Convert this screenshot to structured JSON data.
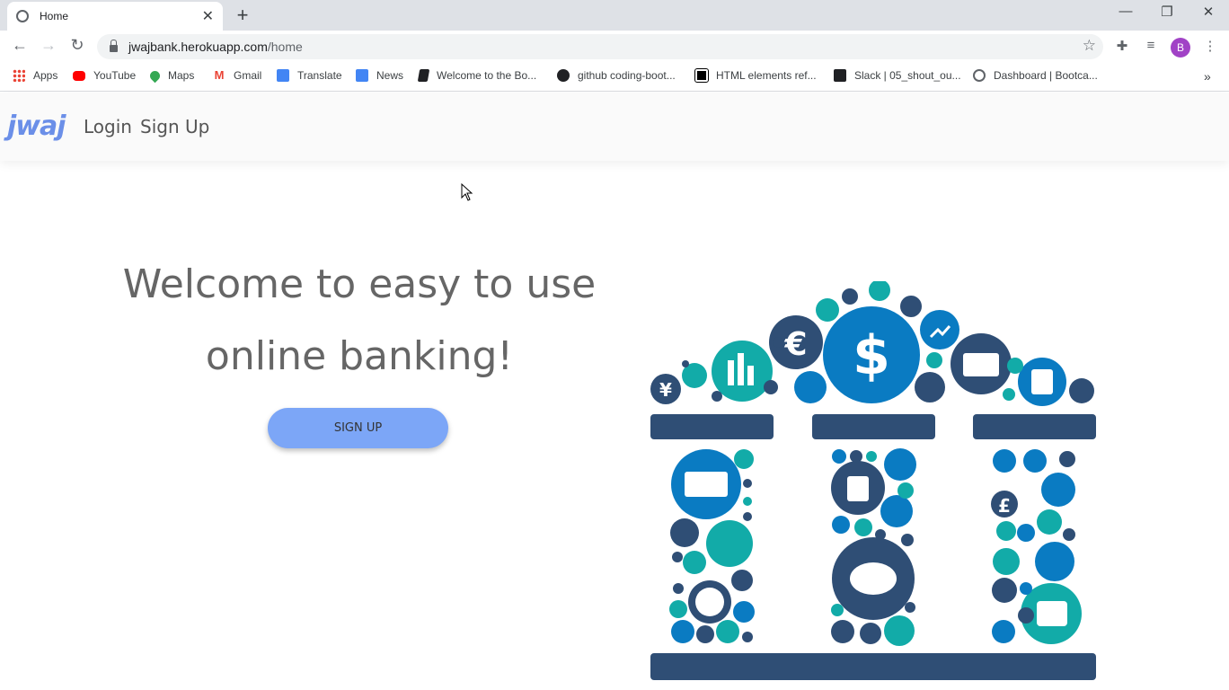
{
  "browser": {
    "tab_title": "Home",
    "tab_close": "✕",
    "new_tab": "+",
    "window_minimize": "—",
    "window_restore": "❐",
    "window_close": "✕",
    "url_host": "jwajbank.herokuapp.com",
    "url_path": "/home",
    "avatar_letter": "B",
    "bookmarks": [
      {
        "label": "Apps",
        "icon": "apps-grid-icon"
      },
      {
        "label": "YouTube",
        "icon": "youtube-icon"
      },
      {
        "label": "Maps",
        "icon": "maps-icon"
      },
      {
        "label": "Gmail",
        "icon": "gmail-icon"
      },
      {
        "label": "Translate",
        "icon": "translate-icon"
      },
      {
        "label": "News",
        "icon": "news-icon"
      },
      {
        "label": "Welcome to the Bo...",
        "icon": "book-icon"
      },
      {
        "label": "github coding-boot...",
        "icon": "github-icon"
      },
      {
        "label": "HTML elements ref...",
        "icon": "mdn-icon"
      },
      {
        "label": "Slack | 05_shout_ou...",
        "icon": "slack-icon"
      },
      {
        "label": "Dashboard | Bootca...",
        "icon": "globe-icon"
      }
    ],
    "more_bookmarks": "»"
  },
  "navbar": {
    "logo": "jwaj",
    "login": "Login",
    "signup": "Sign Up"
  },
  "hero": {
    "line1": "Welcome to easy to use",
    "line2": "online banking!",
    "button": "SIGN UP"
  },
  "colors": {
    "accent": "#7ca6f7",
    "navy": "#2f4e75",
    "blue": "#0a7bc2",
    "teal": "#12aba8"
  }
}
